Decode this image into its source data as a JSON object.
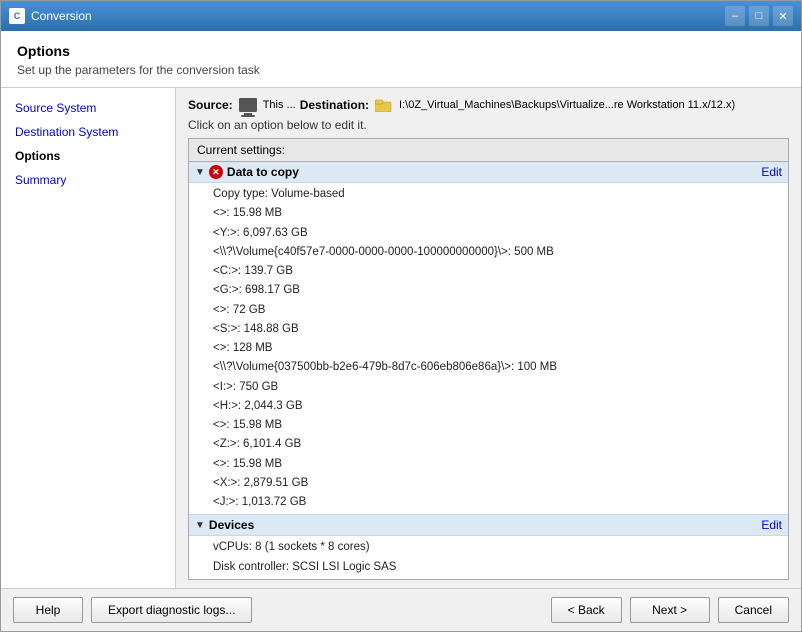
{
  "window": {
    "title": "Conversion",
    "icon": "C"
  },
  "header": {
    "title": "Options",
    "subtitle": "Set up the parameters for the conversion task"
  },
  "sidebar": {
    "items": [
      {
        "id": "source-system",
        "label": "Source System",
        "active": false
      },
      {
        "id": "destination-system",
        "label": "Destination System",
        "active": false
      },
      {
        "id": "options",
        "label": "Options",
        "active": true
      },
      {
        "id": "summary",
        "label": "Summary",
        "active": false
      }
    ]
  },
  "content": {
    "source_label": "Source:",
    "source_icon": "computer",
    "source_value": "This ...",
    "dest_label": "Destination:",
    "dest_icon": "folder",
    "dest_value": "I:\\0Z_Virtual_Machines\\Backups\\Virtualize...re Workstation 11.x/12.x)",
    "click_hint": "Click on an option below to edit it.",
    "settings_header": "Current settings:",
    "sections": [
      {
        "id": "data-to-copy",
        "title": "Data to copy",
        "has_error": true,
        "edit_label": "Edit",
        "rows": [
          "Copy type: Volume-based",
          "<>: 15.98 MB",
          "<Y:>: 6,097.63 GB",
          "<\\\\?\\Volume{c40f57e7-0000-0000-0000-100000000000}\\>: 500 MB",
          "<C:>: 139.7 GB",
          "<G:>: 698.17 GB",
          "<>: 72 GB",
          "<S:>: 148.88 GB",
          "<>: 128 MB",
          "<\\\\?\\Volume{037500bb-b2e6-479b-8d7c-606eb806e86a}\\>: 100 MB",
          "<I:>: 750 GB",
          "<H:>: 2,044.3 GB",
          "<>: 15.98 MB",
          "<Z:>: 6,101.4 GB",
          "<>: 15.98 MB",
          "<X:>: 2,879.51 GB",
          "<J:>: 1,013.72 GB"
        ]
      },
      {
        "id": "devices",
        "title": "Devices",
        "has_error": false,
        "edit_label": "Edit",
        "rows": [
          "vCPUs: 8 (1 sockets * 8 cores)",
          "Disk controller: SCSI LSI Logic SAS"
        ]
      }
    ]
  },
  "footer": {
    "help_label": "Help",
    "export_label": "Export diagnostic logs...",
    "back_label": "< Back",
    "next_label": "Next >",
    "cancel_label": "Cancel"
  }
}
